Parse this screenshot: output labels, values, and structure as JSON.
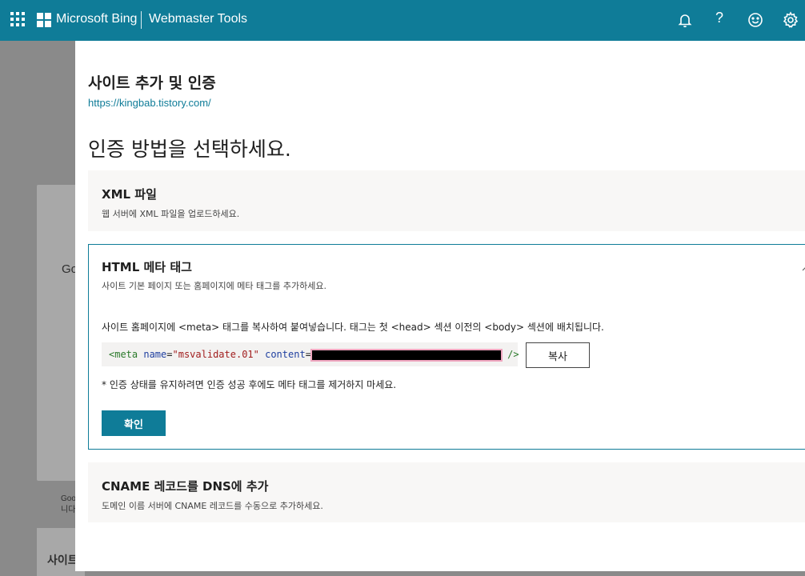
{
  "topbar": {
    "brand": "Microsoft Bing",
    "product": "Webmaster Tools",
    "help": "?"
  },
  "background": {
    "card_text": "Go",
    "card_caption_line1": "Goo",
    "card_caption_line2": "니다",
    "section_label": "사이트"
  },
  "panel": {
    "title": "사이트 추가 및 인증",
    "site_url": "https://kingbab.tistory.com/",
    "method_heading": "인증 방법을 선택하세요.",
    "options": {
      "xml": {
        "title": "XML 파일",
        "description": "웹 서버에 XML 파일을 업로드하세요."
      },
      "html_meta": {
        "title": "HTML 메타 태그",
        "description": "사이트 기본 페이지 또는 홈페이지에 메타 태그를 추가하세요.",
        "instruction": "사이트 홈페이지에 <meta> 태그를 복사하여 붙여넣습니다. 태그는 첫 <head> 섹션 이전의 <body> 섹션에 배치됩니다.",
        "code": {
          "open": "<meta",
          "name_attr": "name",
          "name_value": "\"msvalidate.01\"",
          "content_attr": "content",
          "close": "/>"
        },
        "copy_label": "복사",
        "note": "* 인증 상태를 유지하려면 인증 성공 후에도 메타 태그를 제거하지 마세요.",
        "confirm_label": "확인"
      },
      "cname": {
        "title": "CNAME 레코드를 DNS에 추가",
        "description": "도메인 이름 서버에 CNAME 레코드를 수동으로 추가하세요."
      }
    }
  },
  "colors": {
    "brand": "#0f7c98",
    "panel_bg": "#ffffff",
    "option_bg": "#f8f7f6"
  },
  "icons": [
    "apps-grid-icon",
    "microsoft-logo-icon",
    "bell-icon",
    "help-icon",
    "smiley-icon",
    "gear-icon"
  ]
}
